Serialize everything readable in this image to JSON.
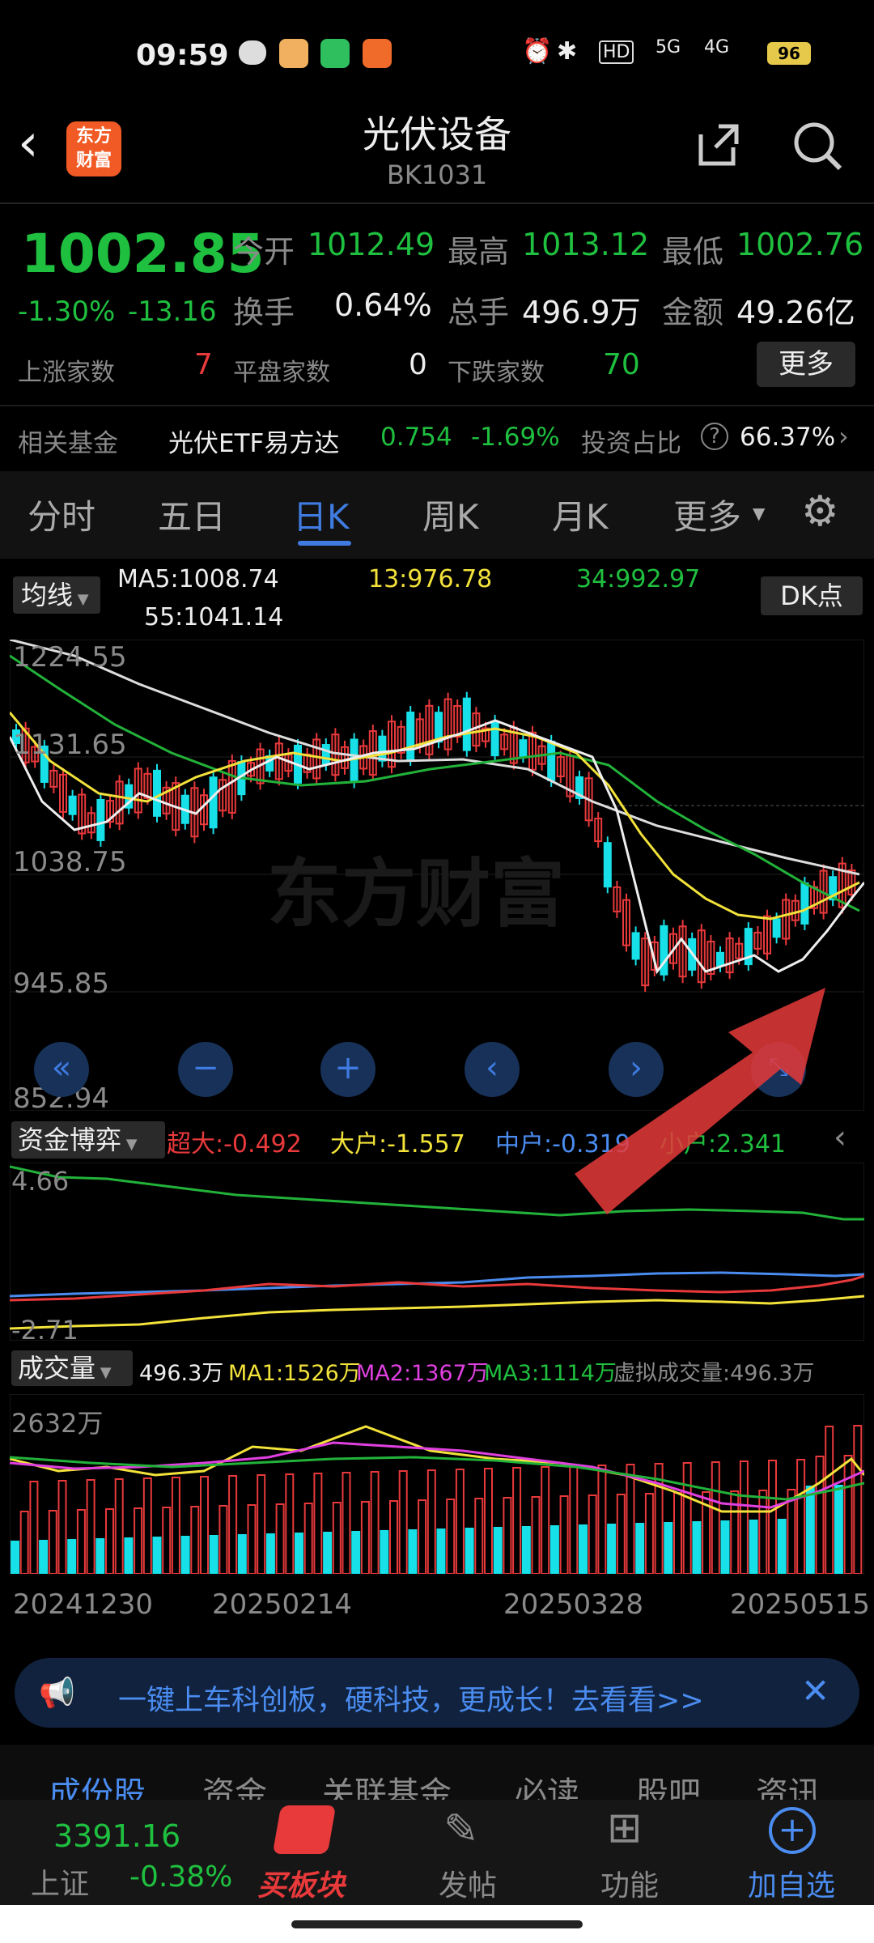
{
  "status": {
    "time": "09:59",
    "battery": "96",
    "net1": "5G",
    "net2": "4G"
  },
  "header": {
    "title": "光伏设备",
    "code": "BK1031",
    "logo_line1": "东方",
    "logo_line2": "财富"
  },
  "quote": {
    "price": "1002.85",
    "chg_pct": "-1.30%",
    "chg": "-13.16",
    "open_label": "今开",
    "open": "1012.49",
    "high_label": "最高",
    "high": "1013.12",
    "low_label": "最低",
    "low": "1002.76",
    "turnover_label": "换手",
    "turnover": "0.64%",
    "vol_label": "总手",
    "vol": "496.9万",
    "amt_label": "金额",
    "amt": "49.26亿",
    "up_label": "上涨家数",
    "up": "7",
    "flat_label": "平盘家数",
    "flat": "0",
    "down_label": "下跌家数",
    "down": "70",
    "more": "更多"
  },
  "fund": {
    "label": "相关基金",
    "name": "光伏ETF易方达",
    "price": "0.754",
    "pct": "-1.69%",
    "ratio_label": "投资占比",
    "ratio": "66.37%"
  },
  "tabs": [
    "分时",
    "五日",
    "日K",
    "周K",
    "月K",
    "更多"
  ],
  "ma": {
    "selector": "均线",
    "ma5": "MA5:1008.74",
    "ma13": "13:976.78",
    "ma34": "34:992.97",
    "ma55": "55:1041.14",
    "dk": "DK点"
  },
  "yaxis": [
    "1224.55",
    "1131.65",
    "1038.75",
    "945.85",
    "852.94"
  ],
  "capital": {
    "selector": "资金博弈",
    "super": "超大:-0.492",
    "large": "大户:-1.557",
    "mid": "中户:-0.319",
    "small": "小户:2.341",
    "top": "4.66",
    "bottom": "-2.71"
  },
  "volume": {
    "selector": "成交量",
    "vol": "496.3万",
    "ma1": "MA1:1526万",
    "ma2": "MA2:1367万",
    "ma3": "MA3:1114万",
    "virtual": "虚拟成交量:496.3万",
    "top": "2632万"
  },
  "dates": [
    "20241230",
    "20250214",
    "20250328",
    "20250515"
  ],
  "banner": {
    "text": "一键上车科创板，硬科技，更成长！去看看>>"
  },
  "subtabs": [
    "成份股",
    "资金",
    "关联基金",
    "必读",
    "股吧",
    "资讯"
  ],
  "bottom": {
    "index_value": "3391.16",
    "index_name": "上证",
    "index_pct": "-0.38%",
    "buy": "买板块",
    "post": "发帖",
    "func": "功能",
    "fav": "加自选"
  },
  "colors": {
    "green": "#1fbf3f",
    "red": "#e8393b",
    "yellow": "#f2e23a",
    "blue": "#4a8cf0",
    "cyan": "#17e0e8"
  }
}
